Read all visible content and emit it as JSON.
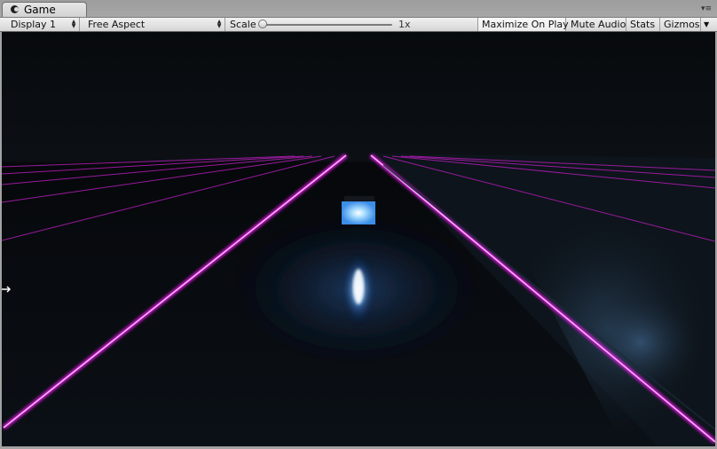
{
  "tab": {
    "label": "Game",
    "icon": "unity-logo-icon",
    "menu_icon": "panel-menu-icon"
  },
  "toolbar": {
    "display_label": "Display 1",
    "aspect_label": "Free Aspect",
    "scale_label": "Scale",
    "scale_value": "1x",
    "scale_level": 0,
    "maximize_label": "Maximize On Play",
    "mute_label": "Mute Audio",
    "stats_label": "Stats",
    "gizmos_label": "Gizmos"
  },
  "scene": {
    "sky_color": "#0a0d11",
    "floor_color": "#050609",
    "grid_line_color": "#ff1cff",
    "player_color": "#4aa8ff",
    "player_glow_color": "#cfe9ff"
  }
}
